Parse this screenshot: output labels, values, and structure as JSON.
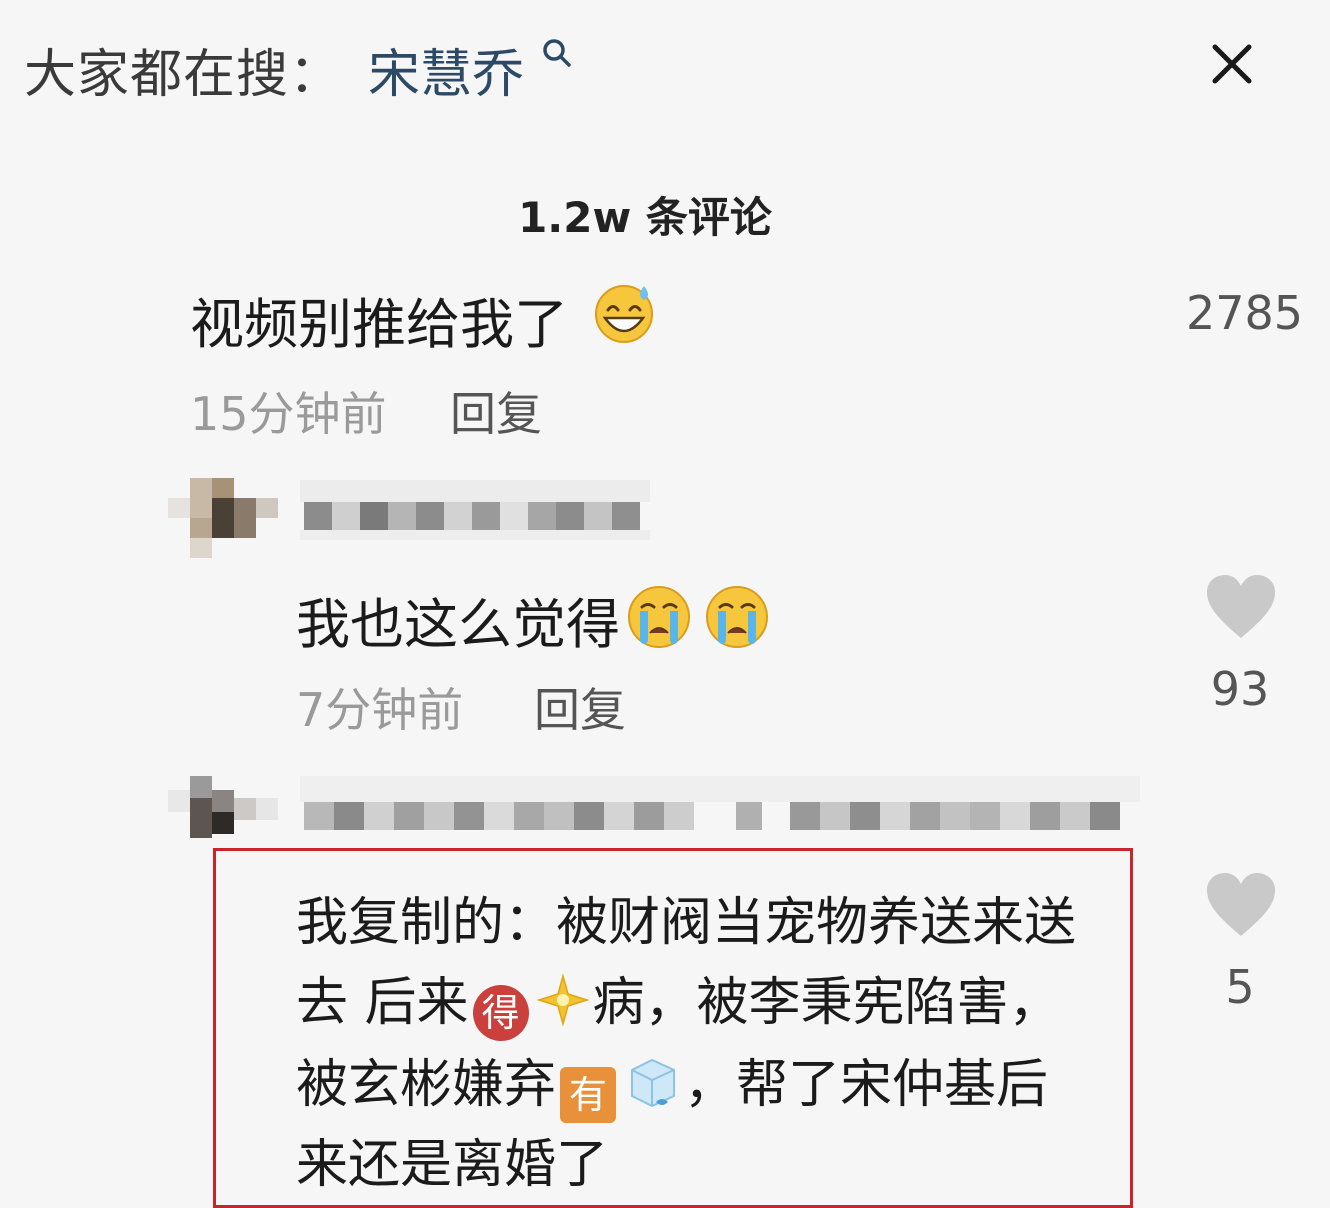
{
  "search_bar": {
    "prefix": "大家都在搜：",
    "term": "宋慧乔"
  },
  "icons": {
    "search": "search-icon",
    "close": "close-icon",
    "heart": "heart-icon"
  },
  "comment_count_label": "1.2w 条评论",
  "comments": [
    {
      "text": "视频别推给我了",
      "emoji": "grinning-sweat-emoji",
      "likes": "2785",
      "time": "15分钟前",
      "reply_label": "回复"
    }
  ],
  "replies": [
    {
      "text": "我也这么觉得",
      "emoji": [
        "crying-emoji",
        "crying-emoji"
      ],
      "time": "7分钟前",
      "reply_label": "回复",
      "likes": "93"
    },
    {
      "lines": {
        "l1": "我复制的：被财阀当宠物养送来送",
        "l2_a": "去 后来",
        "l2_badge": "得",
        "l2_b": "病，被李秉宪陷害，",
        "l3_a": "被玄彬嫌弃",
        "l3_badge": "有",
        "l3_b": "，帮了宋仲基后",
        "l4": "来还是离婚了"
      },
      "likes": "5"
    }
  ],
  "colors": {
    "highlight_box": "#c8242a",
    "search_term": "#2c4a66",
    "badge_red": "#c9403c",
    "badge_orange": "#e8913a"
  }
}
